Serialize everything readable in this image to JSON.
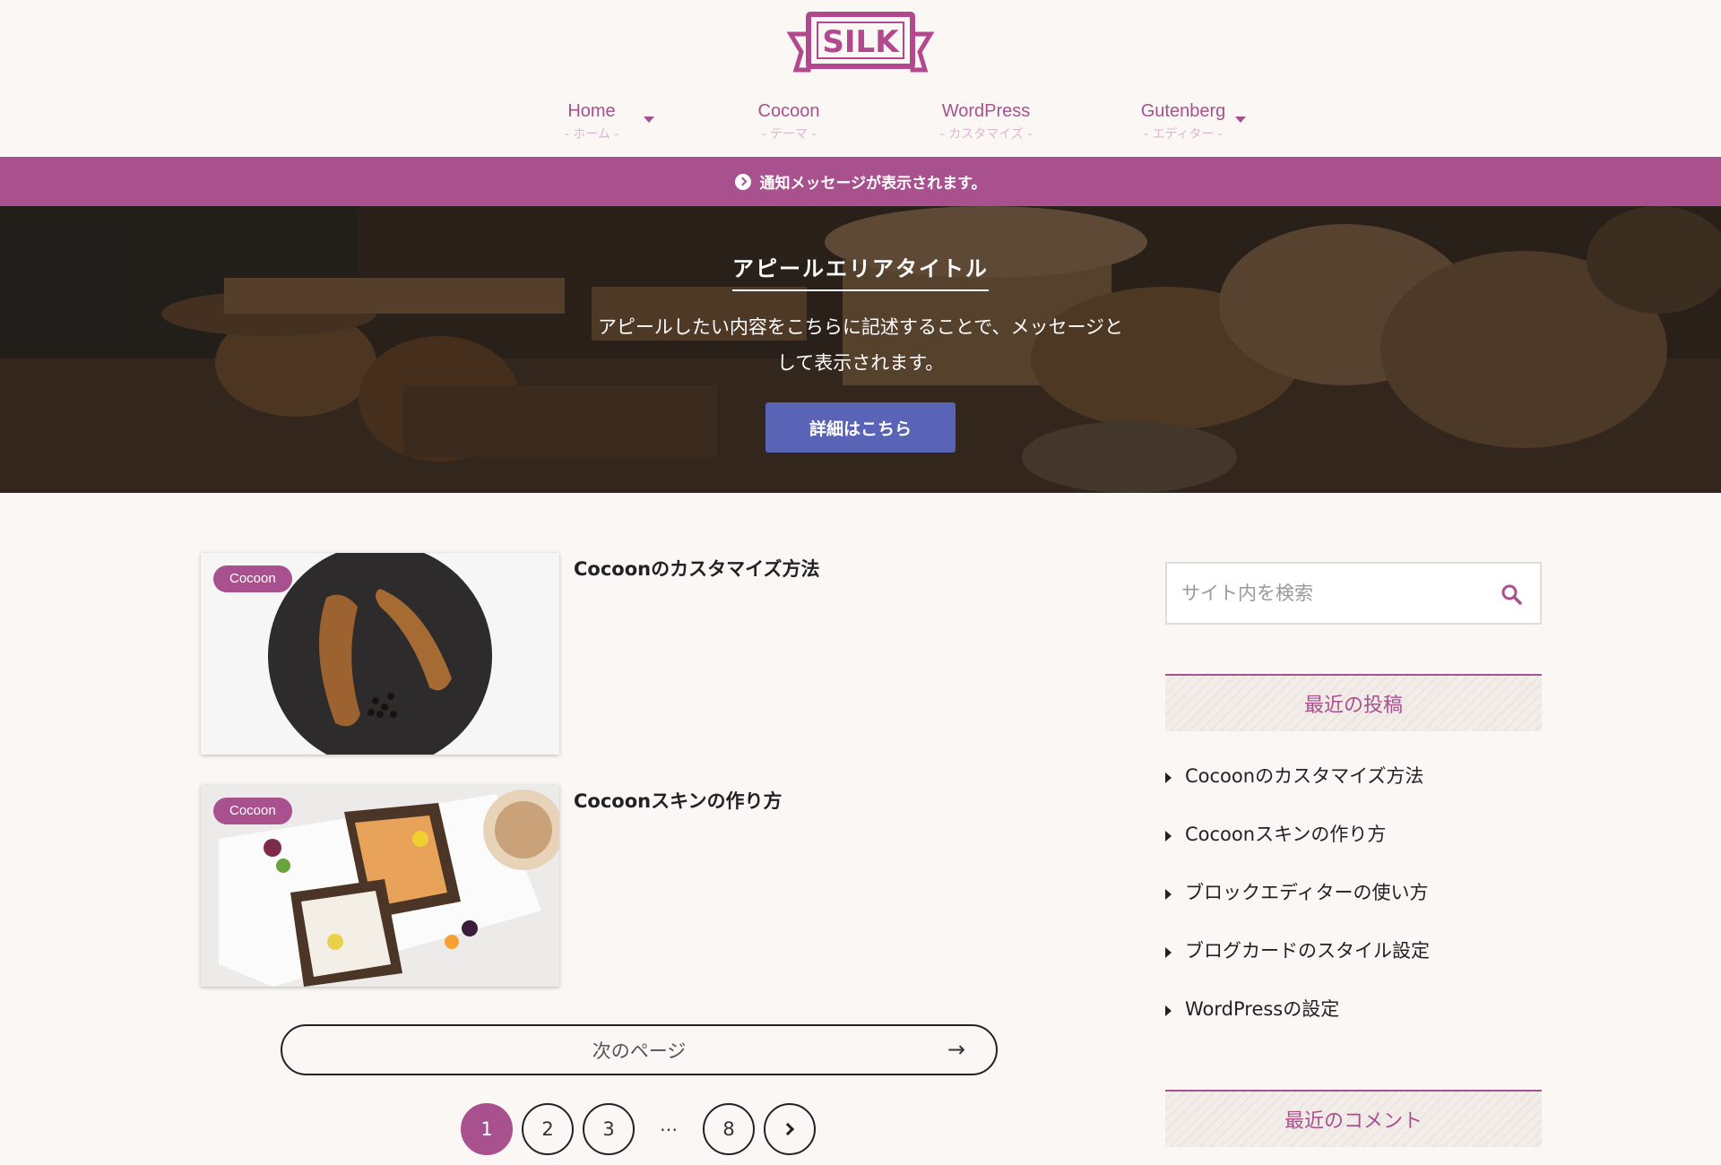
{
  "logo": {
    "text": "SILK",
    "color": "#b2498f"
  },
  "nav": [
    {
      "label": "Home",
      "sub": "- ホーム -",
      "has_dropdown": false
    },
    {
      "label": "Cocoon",
      "sub": "- テーマ -",
      "has_dropdown": false
    },
    {
      "label": "WordPress",
      "sub": "- カスタマイズ -",
      "has_dropdown": true
    },
    {
      "label": "Gutenberg",
      "sub": "- エディター -",
      "has_dropdown": true
    }
  ],
  "notice": {
    "text": "通知メッセージが表示されます。",
    "color": "#a9508e"
  },
  "appeal": {
    "title": "アピールエリアタイトル",
    "line1": "アピールしたい内容をこちらに記述することで、メッセージと",
    "line2": "して表示されます。",
    "button": "詳細はこちら",
    "button_color": "#5a64b6"
  },
  "posts": [
    {
      "title": "Cocoonのカスタマイズ方法",
      "category": "Cocoon",
      "image": "croissants-on-plate"
    },
    {
      "title": "Cocoonスキンの作り方",
      "category": "Cocoon",
      "image": "open-toast-breakfast"
    }
  ],
  "pagination": {
    "next_label": "次のページ",
    "next_arrow": "→",
    "pages": [
      "1",
      "2",
      "3",
      "…",
      "8"
    ],
    "current": "1"
  },
  "sidebar": {
    "search_placeholder": "サイト内を検索",
    "recent_posts_title": "最近の投稿",
    "recent_posts": [
      "Cocoonのカスタマイズ方法",
      "Cocoonスキンの作り方",
      "ブロックエディターの使い方",
      "ブログカードのスタイル設定",
      "WordPressの設定"
    ],
    "recent_comments_title": "最近のコメント"
  }
}
